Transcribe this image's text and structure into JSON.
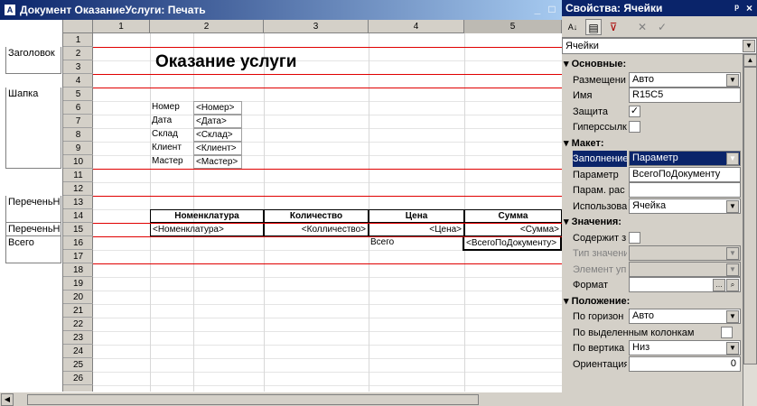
{
  "window": {
    "title": "Документ ОказаниеУслуги: Печать",
    "icon": "A",
    "min": "_",
    "max": "□"
  },
  "groups": [
    "Заголовок",
    "Шапка",
    "ПереченьНо",
    "ПереченьНо",
    "Всего"
  ],
  "columns": [
    "1",
    "2",
    "3",
    "4",
    "5"
  ],
  "rows": [
    "1",
    "2",
    "3",
    "4",
    "5",
    "6",
    "7",
    "8",
    "9",
    "10",
    "11",
    "12",
    "13",
    "14",
    "15",
    "16",
    "17",
    "18",
    "19",
    "20",
    "21",
    "22",
    "23",
    "24",
    "25",
    "26"
  ],
  "cells": {
    "title": "Оказание услуги",
    "r5a": "Номер",
    "r5b": "<Номер>",
    "r6a": "Дата",
    "r6b": "<Дата>",
    "r7a": "Склад",
    "r7b": "<Склад>",
    "r8a": "Клиент",
    "r8b": "<Клиент>",
    "r9a": "Мастер",
    "r9b": "<Мастер>",
    "h1": "Номенклатура",
    "h2": "Количество",
    "h3": "Цена",
    "h4": "Сумма",
    "d1": "<Номенклатура>",
    "d2": "<Колличество>",
    "d3": "<Цена>",
    "d4": "<Сумма>",
    "t1": "Всего",
    "t2": "<ВсегоПоДокументу>"
  },
  "props": {
    "title": "Свойства: Ячейки",
    "pin": "ᵖ",
    "close": "×",
    "tools": {
      "sort": "A↓",
      "cat": "▤",
      "filter": "⊽",
      "del": "✕",
      "ok": "✓"
    },
    "selector": "Ячейки",
    "sections": {
      "basic": "Основные:",
      "layout": "Макет:",
      "values": "Значения:",
      "position": "Положение:"
    },
    "fields": {
      "placement": {
        "label": "Размещени",
        "value": "Авто"
      },
      "name": {
        "label": "Имя",
        "value": "R15C5"
      },
      "protect": {
        "label": "Защита",
        "checked": "✓"
      },
      "hyper": {
        "label": "Гиперссылк",
        "checked": ""
      },
      "fill": {
        "label": "Заполнение",
        "value": "Параметр"
      },
      "param": {
        "label": "Параметр",
        "value": "ВсегоПоДокументу"
      },
      "paramdec": {
        "label": "Парам. рас",
        "value": ""
      },
      "usage": {
        "label": "Использова",
        "value": "Ячейка"
      },
      "contains": {
        "label": "Содержит з",
        "checked": ""
      },
      "valtype": {
        "label": "Тип значени",
        "value": ""
      },
      "ctrl": {
        "label": "Элемент уп",
        "value": ""
      },
      "format": {
        "label": "Формат",
        "value": ""
      },
      "horiz": {
        "label": "По горизон",
        "value": "Авто"
      },
      "selcols": {
        "label": "По выделенным колонкам",
        "checked": ""
      },
      "vert": {
        "label": "По вертика",
        "value": "Низ"
      },
      "orient": {
        "label": "Ориентация",
        "value": "0"
      }
    }
  }
}
